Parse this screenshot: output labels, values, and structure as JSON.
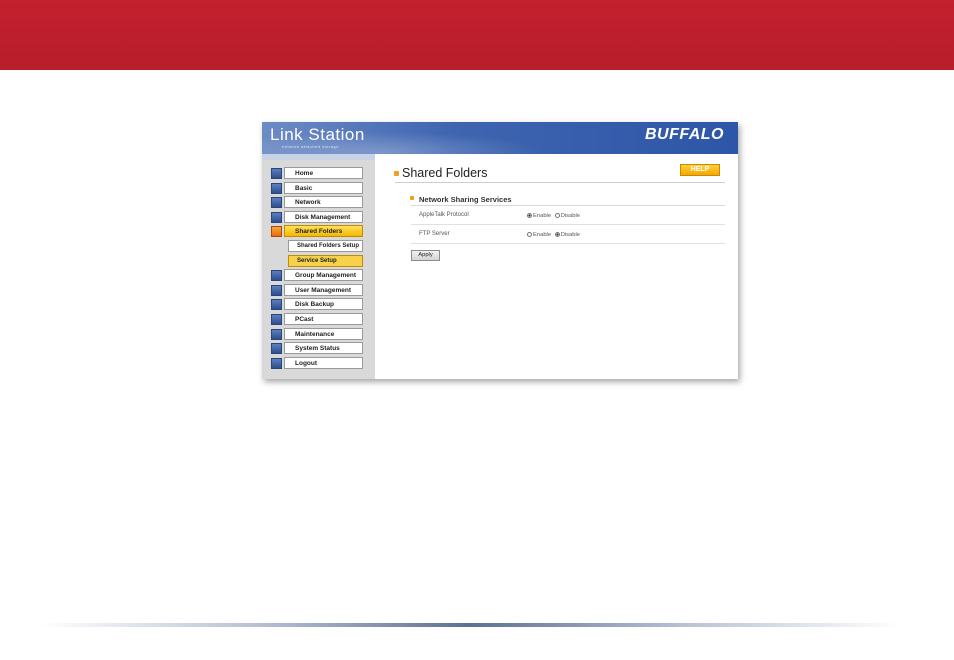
{
  "app": {
    "brand": "Link Station",
    "tagline": "network attached storage",
    "logo": "BUFFALO"
  },
  "nav": [
    {
      "label": "Home",
      "icon": "home-icon",
      "selected": false,
      "sub": false
    },
    {
      "label": "Basic",
      "icon": "basic-settings-icon",
      "selected": false,
      "sub": false
    },
    {
      "label": "Network",
      "icon": "network-icon",
      "selected": false,
      "sub": false
    },
    {
      "label": "Disk Management",
      "icon": "disk-icon",
      "selected": false,
      "sub": false
    },
    {
      "label": "Shared Folders",
      "icon": "folder-icon",
      "selected": true,
      "sub": false
    },
    {
      "label": "Shared Folders Setup",
      "icon": "",
      "selected": false,
      "sub": true
    },
    {
      "label": "Service Setup",
      "icon": "",
      "selected": true,
      "sub": true
    },
    {
      "label": "Group Management",
      "icon": "group-icon",
      "selected": false,
      "sub": false
    },
    {
      "label": "User Management",
      "icon": "user-icon",
      "selected": false,
      "sub": false
    },
    {
      "label": "Disk Backup",
      "icon": "backup-icon",
      "selected": false,
      "sub": false
    },
    {
      "label": "PCast",
      "icon": "pcast-icon",
      "selected": false,
      "sub": false
    },
    {
      "label": "Maintenance",
      "icon": "maintenance-icon",
      "selected": false,
      "sub": false
    },
    {
      "label": "System Status",
      "icon": "status-icon",
      "selected": false,
      "sub": false
    },
    {
      "label": "Logout",
      "icon": "logout-icon",
      "selected": false,
      "sub": false
    }
  ],
  "page": {
    "title": "Shared Folders",
    "help_label": "HELP",
    "section_title": "Network Sharing Services",
    "rows": [
      {
        "label": "AppleTalk Protocol",
        "option1": "Enable",
        "option2": "Disable",
        "selected": "Enable"
      },
      {
        "label": "FTP Server",
        "option1": "Enable",
        "option2": "Disable",
        "selected": "Disable"
      }
    ],
    "apply_label": "Apply"
  },
  "colors": {
    "top_band": "#c4202e",
    "banner_blue": "#2d56a8",
    "highlight_yellow": "#f6b800",
    "help_orange": "#f3a800"
  }
}
